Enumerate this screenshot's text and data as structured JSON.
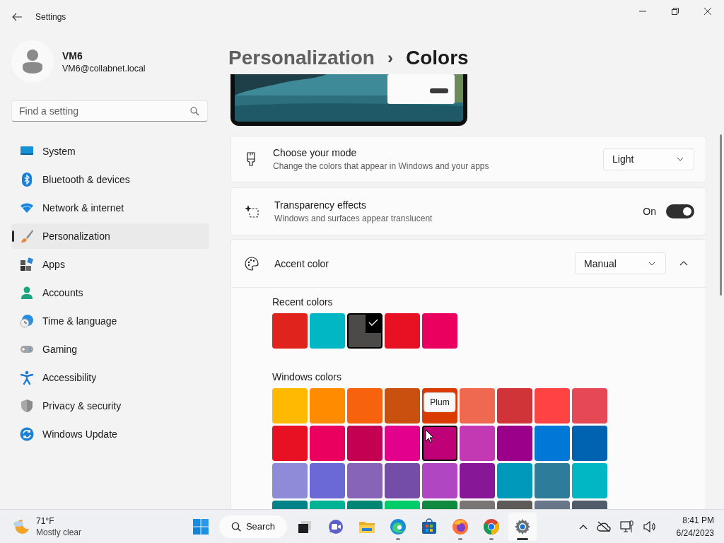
{
  "window": {
    "title": "Settings"
  },
  "user": {
    "name": "VM6",
    "email": "VM6@collabnet.local"
  },
  "search": {
    "placeholder": "Find a setting"
  },
  "nav": [
    {
      "label": "System",
      "kind": "system",
      "selected": false
    },
    {
      "label": "Bluetooth & devices",
      "kind": "bluetooth",
      "selected": false
    },
    {
      "label": "Network & internet",
      "kind": "network",
      "selected": false
    },
    {
      "label": "Personalization",
      "kind": "personalization",
      "selected": true
    },
    {
      "label": "Apps",
      "kind": "apps",
      "selected": false
    },
    {
      "label": "Accounts",
      "kind": "accounts",
      "selected": false
    },
    {
      "label": "Time & language",
      "kind": "time",
      "selected": false
    },
    {
      "label": "Gaming",
      "kind": "gaming",
      "selected": false
    },
    {
      "label": "Accessibility",
      "kind": "accessibility",
      "selected": false
    },
    {
      "label": "Privacy & security",
      "kind": "privacy",
      "selected": false
    },
    {
      "label": "Windows Update",
      "kind": "update",
      "selected": false
    }
  ],
  "breadcrumb": {
    "parent": "Personalization",
    "separator": "›",
    "current": "Colors"
  },
  "mode": {
    "title": "Choose your mode",
    "description": "Change the colors that appear in Windows and your apps",
    "value": "Light"
  },
  "transparency": {
    "title": "Transparency effects",
    "description": "Windows and surfaces appear translucent",
    "state_label": "On",
    "on": true
  },
  "accent": {
    "title": "Accent color",
    "value": "Manual",
    "expanded": true,
    "recent_label": "Recent colors",
    "recent_colors": [
      {
        "color": "#e0231d",
        "selected": false
      },
      {
        "color": "#00b7c3",
        "selected": false
      },
      {
        "color": "#4c4a48",
        "selected": true
      },
      {
        "color": "#e81123",
        "selected": false
      },
      {
        "color": "#ea005e",
        "selected": false
      }
    ],
    "windows_label": "Windows colors",
    "tooltip": "Plum",
    "windows_colors": [
      {
        "color": "#ffb900",
        "hovered": false
      },
      {
        "color": "#ff8c00",
        "hovered": false
      },
      {
        "color": "#f7630c",
        "hovered": false
      },
      {
        "color": "#ca5010",
        "hovered": false
      },
      {
        "color": "#da3b01",
        "hovered": false
      },
      {
        "color": "#ef6950",
        "hovered": false
      },
      {
        "color": "#d13438",
        "hovered": false
      },
      {
        "color": "#ff4343",
        "hovered": false
      },
      {
        "color": "#e74856",
        "hovered": false
      },
      {
        "color": "#e81123",
        "hovered": false
      },
      {
        "color": "#ea005e",
        "hovered": false
      },
      {
        "color": "#c30052",
        "hovered": false
      },
      {
        "color": "#e3008c",
        "hovered": false
      },
      {
        "color": "#bf0077",
        "hovered": true
      },
      {
        "color": "#c239b3",
        "hovered": false
      },
      {
        "color": "#9a0089",
        "hovered": false
      },
      {
        "color": "#0078d7",
        "hovered": false
      },
      {
        "color": "#0063b1",
        "hovered": false
      },
      {
        "color": "#8e8cd8",
        "hovered": false
      },
      {
        "color": "#6b69d6",
        "hovered": false
      },
      {
        "color": "#8764b8",
        "hovered": false
      },
      {
        "color": "#744da9",
        "hovered": false
      },
      {
        "color": "#b146c2",
        "hovered": false
      },
      {
        "color": "#881798",
        "hovered": false
      },
      {
        "color": "#0099bc",
        "hovered": false
      },
      {
        "color": "#2d7d9a",
        "hovered": false
      },
      {
        "color": "#00b7c3",
        "hovered": false
      },
      {
        "color": "#038387",
        "hovered": false
      },
      {
        "color": "#00b294",
        "hovered": false
      },
      {
        "color": "#018574",
        "hovered": false
      },
      {
        "color": "#00cc6a",
        "hovered": false
      },
      {
        "color": "#10893e",
        "hovered": false
      },
      {
        "color": "#7a7574",
        "hovered": false
      },
      {
        "color": "#5d5a58",
        "hovered": false
      },
      {
        "color": "#68768a",
        "hovered": false
      },
      {
        "color": "#515c6b",
        "hovered": false
      }
    ]
  },
  "taskbar": {
    "weather": {
      "temperature": "71°F",
      "condition": "Mostly clear"
    },
    "search_label": "Search",
    "apps": [
      {
        "kind": "taskview",
        "running": false,
        "active": false
      },
      {
        "kind": "chat",
        "running": false,
        "active": false
      },
      {
        "kind": "files",
        "running": false,
        "active": false
      },
      {
        "kind": "edge",
        "running": true,
        "active": false
      },
      {
        "kind": "store",
        "running": false,
        "active": false
      },
      {
        "kind": "firefox",
        "running": true,
        "active": false
      },
      {
        "kind": "chrome",
        "running": true,
        "active": false
      },
      {
        "kind": "settings",
        "running": true,
        "active": true
      }
    ],
    "time": "8:41 PM",
    "date": "6/24/2023"
  }
}
